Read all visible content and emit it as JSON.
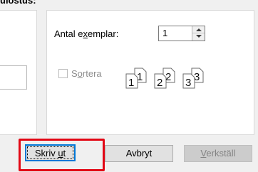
{
  "heading_partial": "ulostus:",
  "copies": {
    "label": "Antal exemplar:",
    "value": "1"
  },
  "collate": {
    "label": "Sortera",
    "checked": false,
    "enabled": false,
    "page_numbers": [
      "1",
      "1",
      "2",
      "2",
      "3",
      "3"
    ]
  },
  "buttons": {
    "print": "Skriv ut",
    "cancel": "Avbryt",
    "apply": "Verkställ"
  },
  "colors": {
    "highlight": "#e20714",
    "focus": "#0078d7"
  },
  "icons": {
    "spin_up": "spin-up-arrow",
    "spin_down": "spin-down-arrow",
    "collate": "collated-pages-icon"
  }
}
